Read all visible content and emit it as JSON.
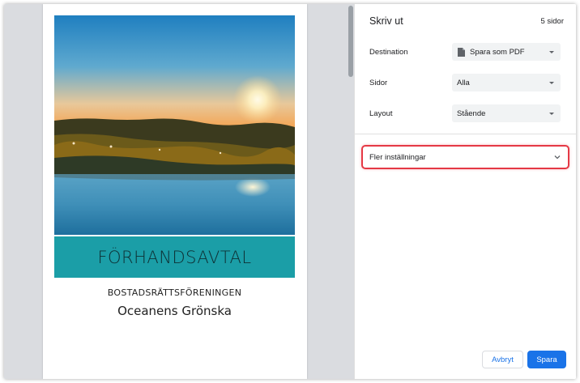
{
  "print_dialog": {
    "title": "Skriv ut",
    "page_count": "5 sidor",
    "destination": {
      "label": "Destination",
      "value": "Spara som PDF",
      "icon": "file-icon"
    },
    "pages": {
      "label": "Sidor",
      "value": "Alla"
    },
    "layout": {
      "label": "Layout",
      "value": "Stående"
    },
    "more_settings": {
      "label": "Fler inställningar",
      "highlight_color": "#e53945"
    },
    "buttons": {
      "cancel": "Avbryt",
      "save": "Spara"
    },
    "accent_color": "#1a73e8"
  },
  "preview": {
    "title": "FÖRHANDSAVTAL",
    "subtitle": "BOSTADSRÄTTSFÖRENINGEN",
    "name": "Oceanens Grönska",
    "band_color": "#1b9ea7"
  }
}
